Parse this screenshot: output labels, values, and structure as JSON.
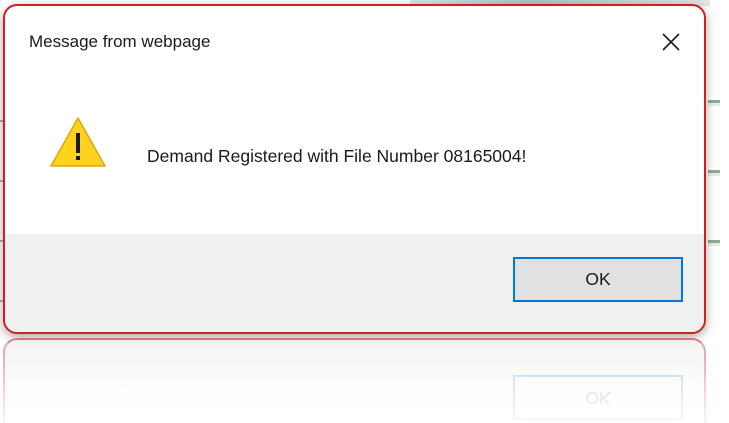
{
  "dialog": {
    "title": "Message from webpage",
    "message": "Demand Registered with File Number 08165004!",
    "icon": "warning-triangle-icon",
    "close_icon": "close-icon",
    "ok_label": "OK"
  },
  "colors": {
    "highlight_border": "#d02020",
    "button_focus": "#0078d7",
    "footer_bg": "#f0f0f0",
    "warning_yellow": "#ffd21f"
  }
}
